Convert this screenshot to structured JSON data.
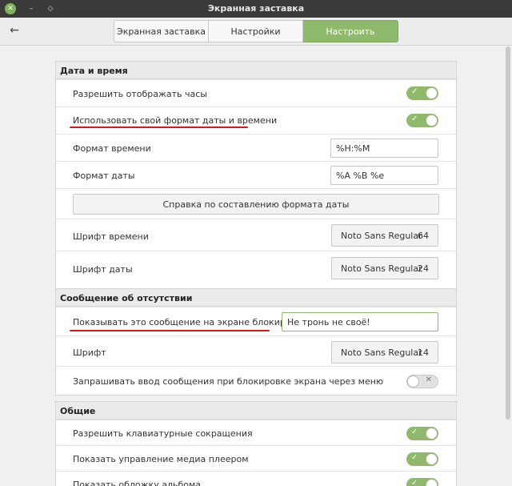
{
  "window": {
    "title": "Экранная заставка"
  },
  "toolbar": {
    "tabs": [
      {
        "label": "Экранная заставка"
      },
      {
        "label": "Настройки"
      },
      {
        "label": "Настроить"
      }
    ]
  },
  "datetime": {
    "header": "Дата и время",
    "show_clock": "Разрешить отображать часы",
    "custom_format": "Использовать свой формат даты и времени",
    "time_format_label": "Формат времени",
    "time_format_value": "%H:%M",
    "date_format_label": "Формат даты",
    "date_format_value": "%A %B %e",
    "help_button": "Справка по составлению формата даты",
    "time_font_label": "Шрифт времени",
    "time_font_name": "Noto Sans Regular",
    "time_font_size": "64",
    "date_font_label": "Шрифт даты",
    "date_font_name": "Noto Sans Regular",
    "date_font_size": "24"
  },
  "away": {
    "header": "Сообщение об отсутствии",
    "show_message_label": "Показывать это сообщение на экране блокировки",
    "message_value": "Не тронь не своё!",
    "font_label": "Шрифт",
    "font_name": "Noto Sans Regular",
    "font_size": "14",
    "ask_message_label": "Запрашивать ввод сообщения при блокировке экрана через меню"
  },
  "general": {
    "header": "Общие",
    "shortcuts": "Разрешить клавиатурные сокращения",
    "media": "Показать управление медиа плеером",
    "album": "Показать обложку альбома"
  },
  "colors": {
    "accent": "#8fba6c",
    "annotation": "#e0161c"
  }
}
